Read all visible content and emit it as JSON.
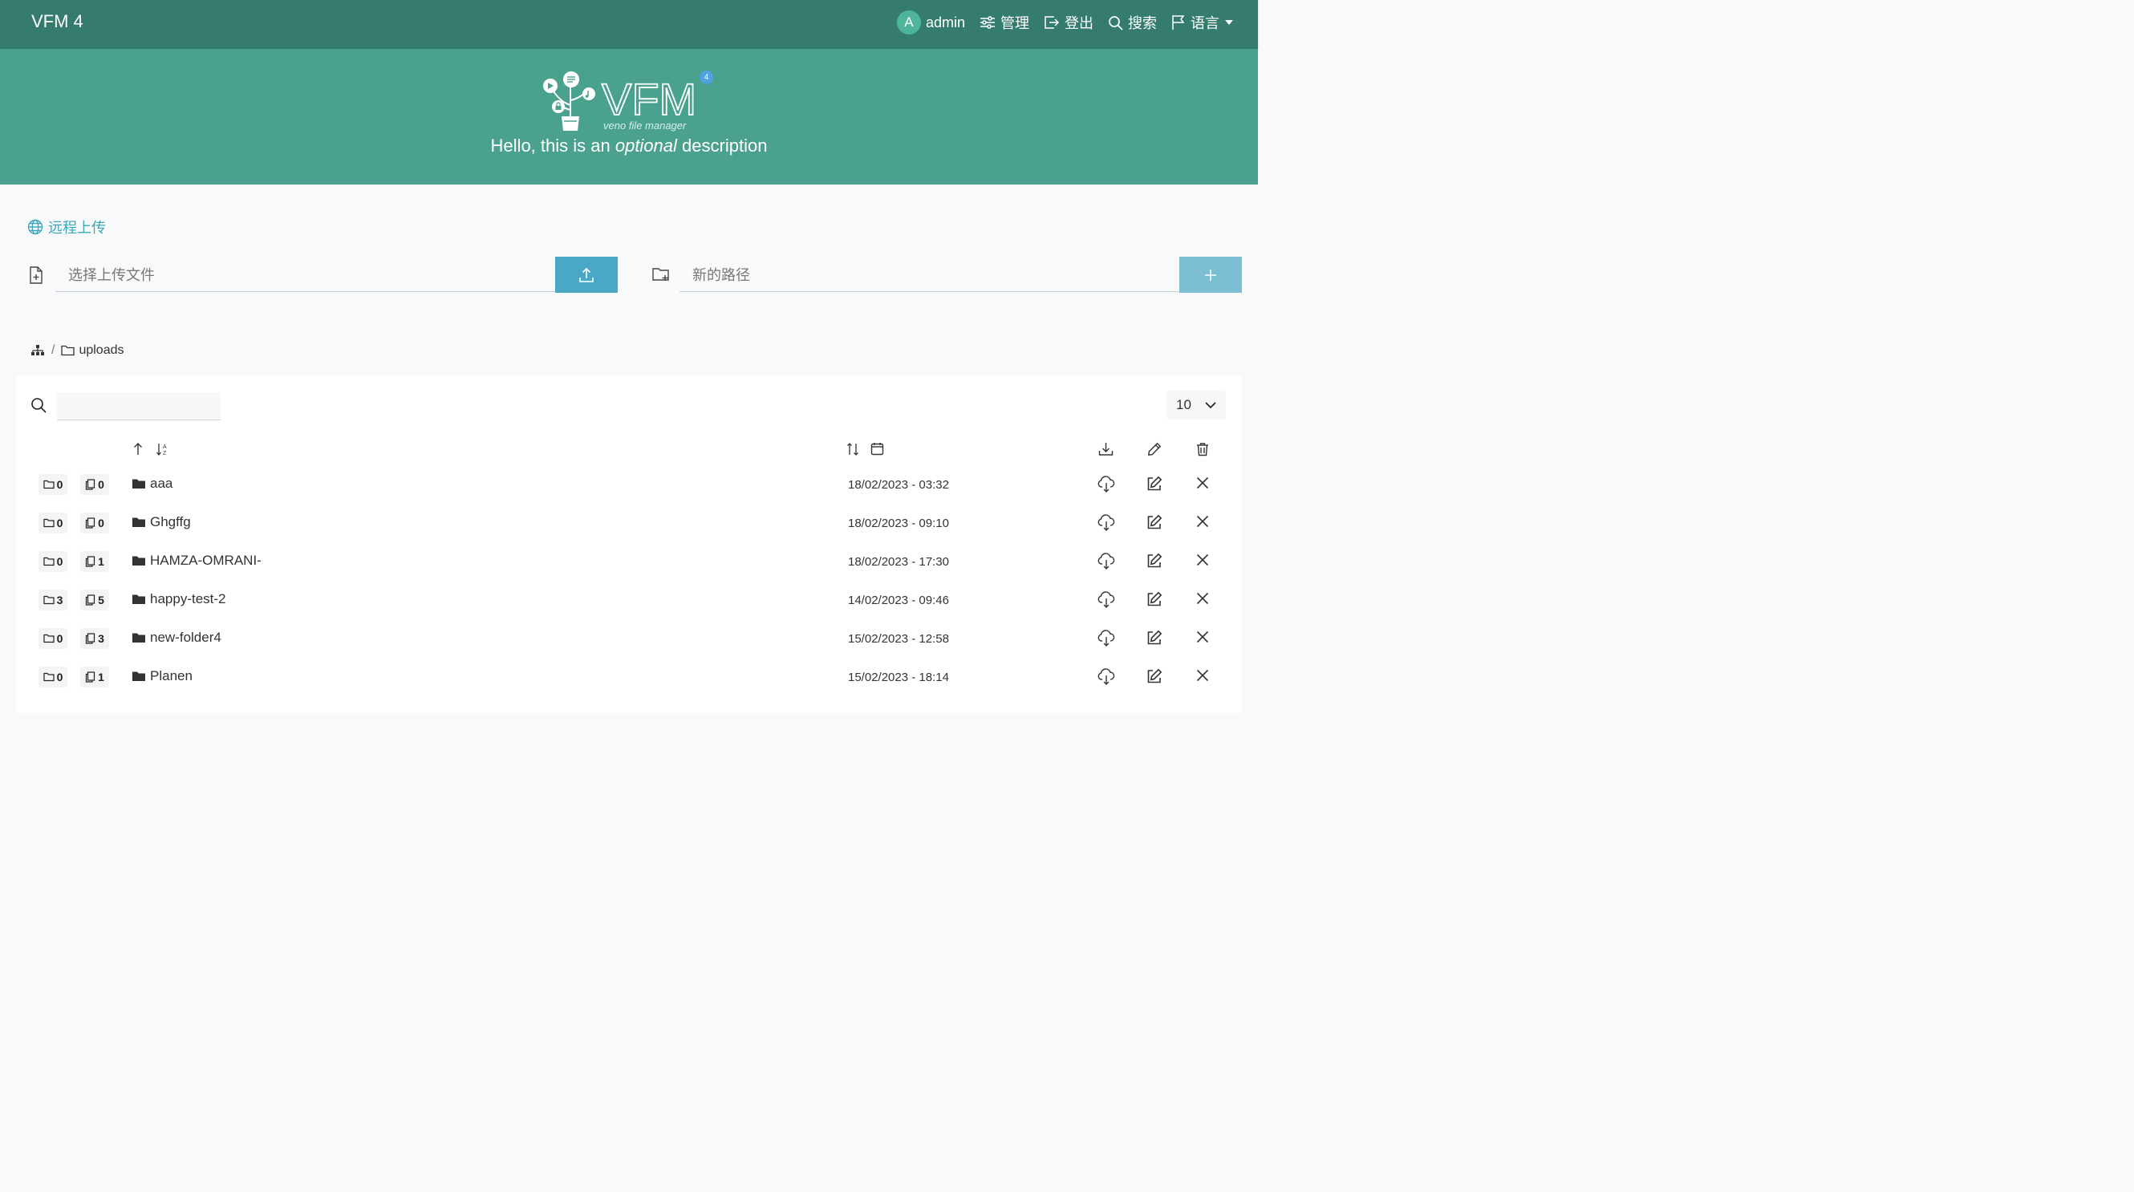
{
  "nav": {
    "brand": "VFM 4",
    "avatar_letter": "A",
    "user": "admin",
    "manage": "管理",
    "logout": "登出",
    "search": "搜索",
    "language": "语言"
  },
  "hero": {
    "logo_text": "VFM",
    "logo_sub": "veno file manager",
    "logo_badge": "4",
    "desc_hello": "Hello,",
    "desc_mid": " this is an ",
    "desc_em": "optional",
    "desc_end": " description"
  },
  "upload": {
    "remote_label": "远程上传",
    "file_placeholder": "选择上传文件",
    "folder_placeholder": "新的路径"
  },
  "breadcrumb": {
    "separator": "/",
    "folder": "uploads"
  },
  "table": {
    "page_size": "10",
    "rows": [
      {
        "folders": "0",
        "files": "0",
        "name": "aaa",
        "date": "18/02/2023 - 03:32"
      },
      {
        "folders": "0",
        "files": "0",
        "name": "Ghgffg",
        "date": "18/02/2023 - 09:10"
      },
      {
        "folders": "0",
        "files": "1",
        "name": "HAMZA-OMRANI-",
        "date": "18/02/2023 - 17:30"
      },
      {
        "folders": "3",
        "files": "5",
        "name": "happy-test-2",
        "date": "14/02/2023 - 09:46"
      },
      {
        "folders": "0",
        "files": "3",
        "name": "new-folder4",
        "date": "15/02/2023 - 12:58"
      },
      {
        "folders": "0",
        "files": "1",
        "name": "Planen",
        "date": "15/02/2023 - 18:14"
      }
    ]
  },
  "colors": {
    "nav_bg": "#357b6e",
    "hero_bg": "#4aa18e",
    "accent": "#3ba7b7",
    "upload_btn": "#4aa8c6",
    "newdir_btn": "#7cbfd2"
  }
}
